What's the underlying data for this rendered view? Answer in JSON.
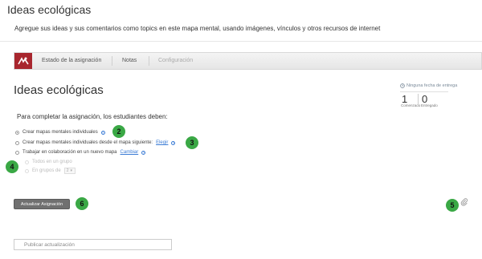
{
  "page": {
    "title": "Ideas ecológicas",
    "description": "Agregue sus ideas y sus comentarios como topics en este mapa mental, usando imágenes, vínculos y otros recursos de internet"
  },
  "toolbar": {
    "tabs": [
      {
        "label": "Estado de la asignación"
      },
      {
        "label": "Notas"
      },
      {
        "label": "Configuración"
      }
    ]
  },
  "assignment": {
    "heading": "Ideas ecológicas",
    "due": "Ninguna fecha de entrega",
    "stats": [
      {
        "value": "1",
        "label": "Comenzado"
      },
      {
        "value": "0",
        "label": "Entregado"
      }
    ],
    "instructions": "Para completar la asignación, los estudiantes deben:",
    "options": [
      {
        "label": "Crear mapas mentales individuales"
      },
      {
        "label": "Crear mapas mentales individuales desde el mapa siguiente:",
        "link": "Elegir"
      },
      {
        "label": "Trabajar en colaboración en un nuevo mapa",
        "link": "Cambiar"
      }
    ],
    "sub_options": [
      {
        "label": "Todos en un grupo"
      },
      {
        "label": "En grupos de",
        "select_value": "2"
      }
    ],
    "update_button": "Actualizar Asignación",
    "post_placeholder": "Publicar actualización"
  },
  "badges": [
    "2",
    "3",
    "4",
    "5",
    "6"
  ],
  "colors": {
    "logo": "#a8262e",
    "badge": "#3aa845",
    "link": "#3a7bd5",
    "button": "#707070"
  }
}
